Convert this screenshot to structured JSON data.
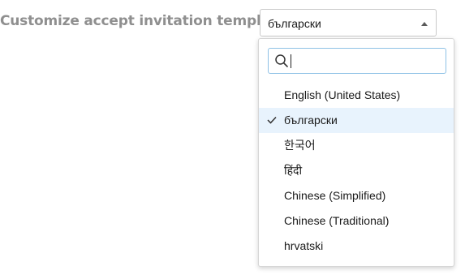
{
  "form": {
    "label": "Customize accept invitation template"
  },
  "language_select": {
    "selected_value": "български",
    "search": {
      "value": "",
      "placeholder": ""
    },
    "options": [
      {
        "label": "English (United States)",
        "selected": false
      },
      {
        "label": "български",
        "selected": true
      },
      {
        "label": "한국어",
        "selected": false
      },
      {
        "label": "हिंदी",
        "selected": false
      },
      {
        "label": "Chinese (Simplified)",
        "selected": false
      },
      {
        "label": "Chinese (Traditional)",
        "selected": false
      },
      {
        "label": "hrvatski",
        "selected": false
      }
    ]
  },
  "icons": {
    "search": "search-icon",
    "check": "check-icon",
    "caret": "caret-up-icon"
  },
  "colors": {
    "label_text": "#8f8f8f",
    "selected_row_bg": "#e8f3fd",
    "search_focus_border": "#8ec1e6"
  }
}
